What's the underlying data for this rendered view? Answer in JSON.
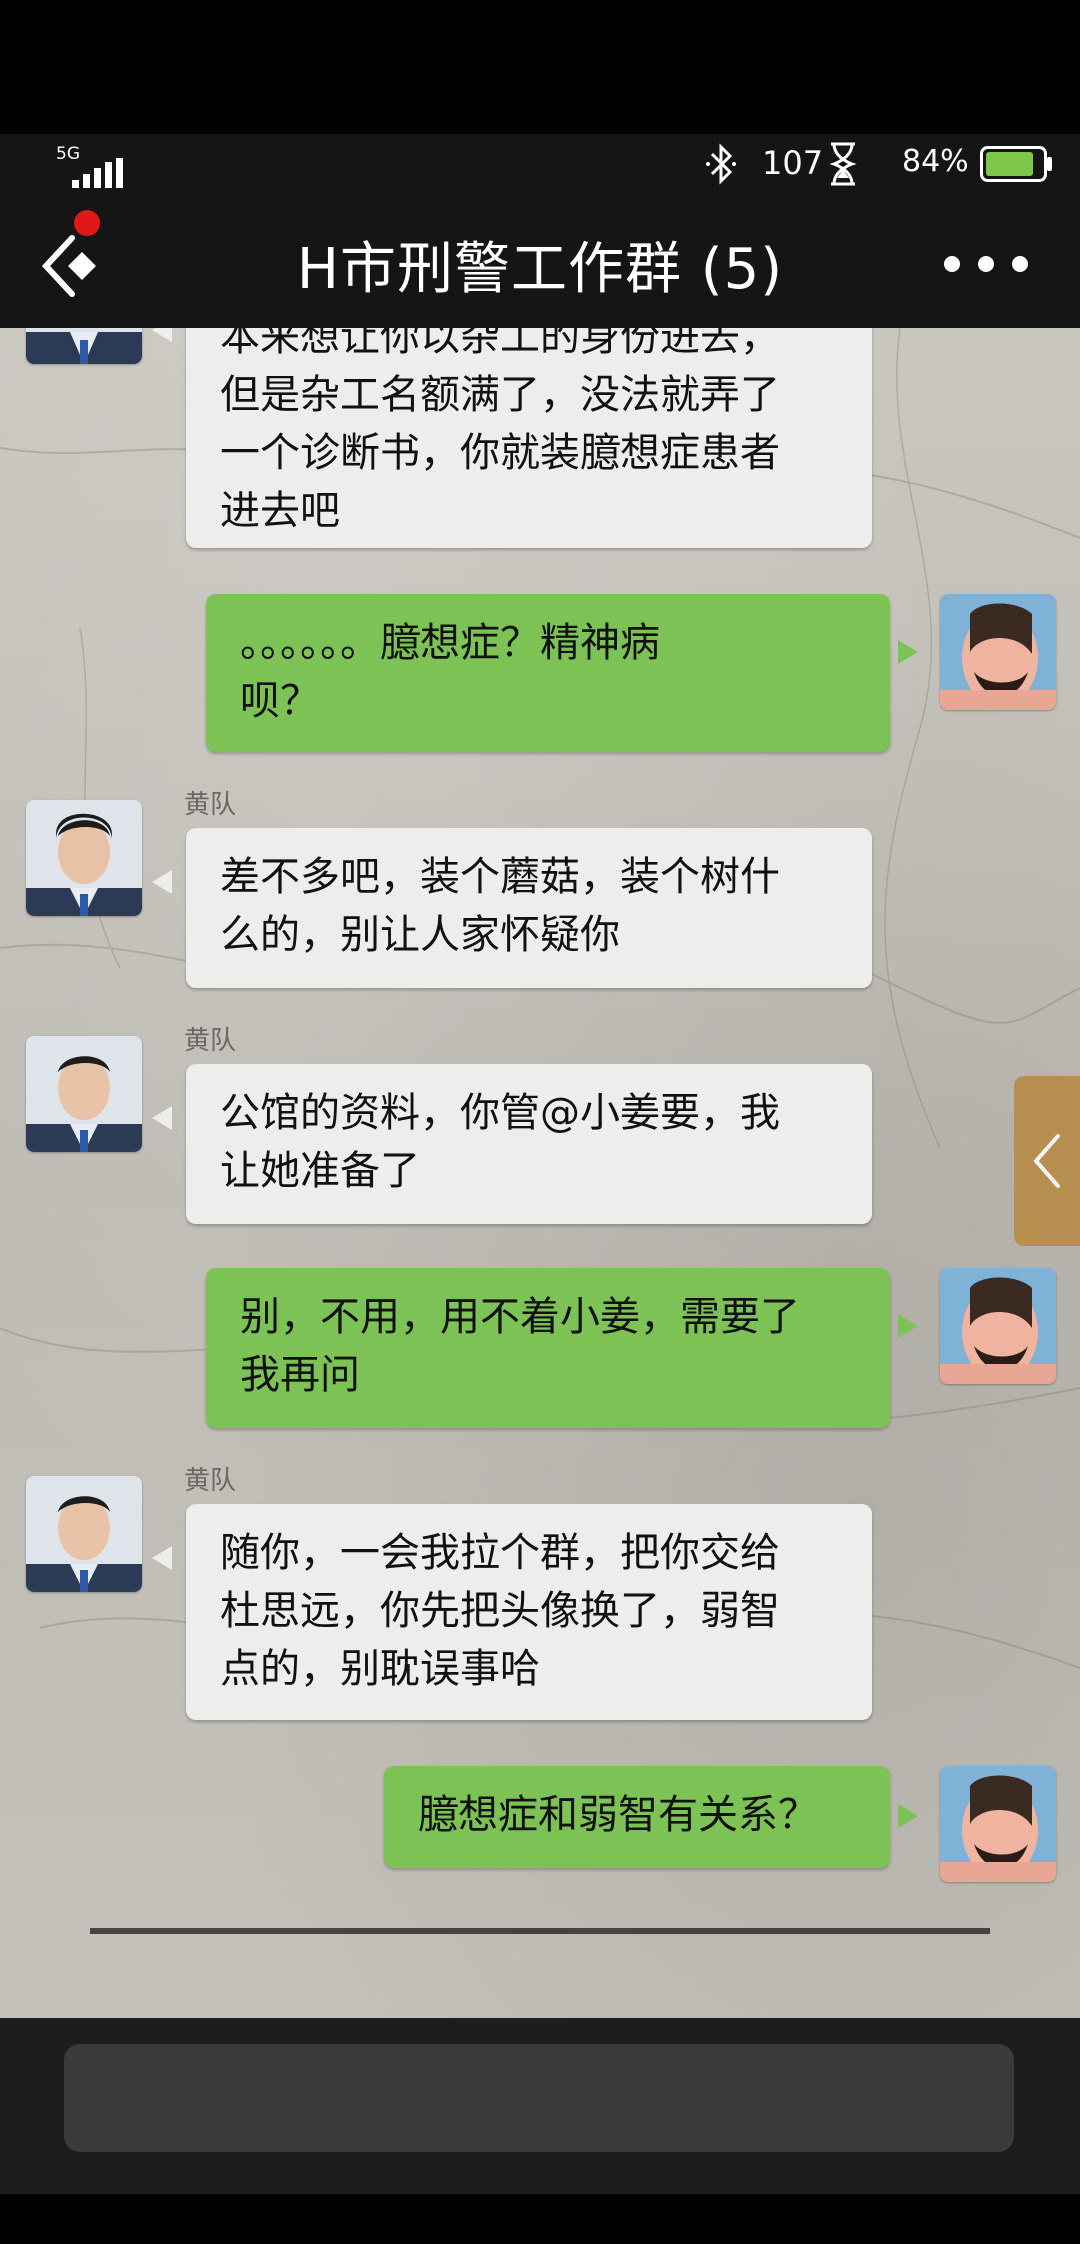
{
  "status_bar": {
    "network": "5G",
    "bluetooth_icon": "bluetooth-icon",
    "rate": "107",
    "battery_percent_text": "84%",
    "battery_level": 0.84
  },
  "header": {
    "title": "H市刑警工作群 (5)",
    "back_icon": "back-arrow-icon",
    "more_icon": "more-dots-icon",
    "unread_dot_color": "#e01818"
  },
  "messages": [
    {
      "side": "left",
      "sender": "",
      "text_lines": [
        "本来想让你以杂工的身份进去，",
        "但是杂工名额满了，没法就弄了",
        "一个诊断书，你就装臆想症患者",
        "进去吧"
      ]
    },
    {
      "side": "right",
      "text_lines": [
        "。。。。。。臆想症？精神病",
        "呗？"
      ]
    },
    {
      "side": "left",
      "sender": "黄队",
      "text_lines": [
        "差不多吧，装个蘑菇，装个树什",
        "么的，别让人家怀疑你"
      ]
    },
    {
      "side": "left",
      "sender": "黄队",
      "text_lines": [
        "公馆的资料，你管@小姜要，我",
        "让她准备了"
      ]
    },
    {
      "side": "right",
      "text_lines": [
        "别，不用，用不着小姜，需要了",
        "我再问"
      ]
    },
    {
      "side": "left",
      "sender": "黄队",
      "text_lines": [
        "随你，一会我拉个群，把你交给",
        "杜思远，你先把头像换了，弱智",
        "点的，别耽误事哈"
      ]
    },
    {
      "side": "right",
      "text_lines": [
        "臆想症和弱智有关系？"
      ]
    }
  ],
  "colors": {
    "bubble_left": "#ededeb",
    "bubble_right": "#7cc255"
  },
  "input": {
    "value": "",
    "placeholder": ""
  }
}
